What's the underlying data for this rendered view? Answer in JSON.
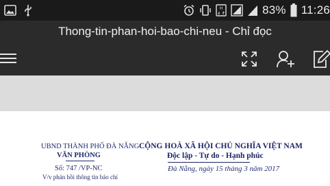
{
  "status_bar": {
    "battery_percent": "83%",
    "time": "11:26",
    "left_icons": [
      "image-icon",
      "usb-icon"
    ],
    "right_icons": [
      "alarm-icon",
      "vibrate-icon",
      "data-icon",
      "signal-icon",
      "signal-icon",
      "battery-icon"
    ]
  },
  "title_bar": {
    "title": "Thong-tin-phan-hoi-bao-chi-neu - Chỉ đọc"
  },
  "toolbar": {
    "icons": [
      "menu-icon",
      "fullscreen-icon",
      "add-person-icon",
      "edit-icon"
    ]
  },
  "document": {
    "org_name": "UBND THÀNH PHỐ ĐÀ NẴNG",
    "office": "VĂN PHÒNG",
    "doc_number": "Số: 747 /VP-NC",
    "subject": "V/v phản hồi thông tin báo chí",
    "republic": "CỘNG HOÀ XÃ HỘI CHỦ NGHĨA VIỆT NAM",
    "motto": "Độc lập - Tự do - Hạnh phúc",
    "date": "Đà Nẵng, ngày 15 tháng 3 năm 2017"
  }
}
